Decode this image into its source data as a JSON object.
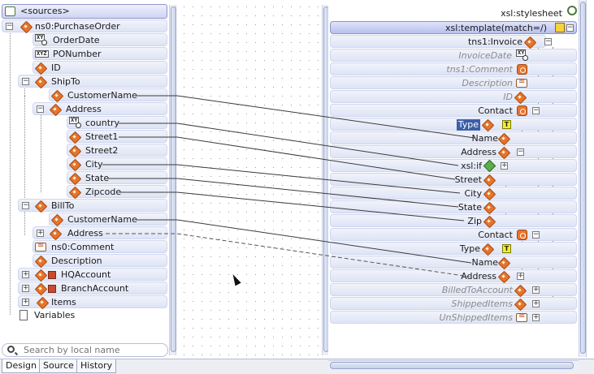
{
  "sources": {
    "header": "<sources>",
    "tree": [
      {
        "label": "ns0:PurchaseOrder",
        "icon": "element-icon",
        "expand": "−"
      },
      {
        "label": "OrderDate",
        "icon": "attribute-icon"
      },
      {
        "label": "PONumber",
        "icon": "attribute-icon"
      },
      {
        "label": "ID",
        "icon": "element-icon"
      },
      {
        "label": "ShipTo",
        "icon": "element-icon",
        "expand": "−"
      },
      {
        "label": "CustomerName",
        "icon": "element-icon"
      },
      {
        "label": "Address",
        "icon": "element-icon",
        "expand": "−"
      },
      {
        "label": "country",
        "icon": "attribute-icon"
      },
      {
        "label": "Street1",
        "icon": "element-icon"
      },
      {
        "label": "Street2",
        "icon": "element-icon"
      },
      {
        "label": "City",
        "icon": "element-icon"
      },
      {
        "label": "State",
        "icon": "element-icon"
      },
      {
        "label": "Zipcode",
        "icon": "element-icon"
      },
      {
        "label": "BillTo",
        "icon": "element-icon",
        "expand": "−"
      },
      {
        "label": "CustomerName",
        "icon": "element-icon"
      },
      {
        "label": "Address",
        "icon": "element-icon",
        "expand": "+"
      },
      {
        "label": "ns0:Comment",
        "icon": "comment-icon"
      },
      {
        "label": "Description",
        "icon": "element-icon"
      },
      {
        "label": "HQAccount",
        "icon": "element-icon",
        "expand": "+"
      },
      {
        "label": "BranchAccount",
        "icon": "element-icon",
        "expand": "+"
      },
      {
        "label": "Items",
        "icon": "element-icon",
        "expand": "+"
      },
      {
        "label": "Variables",
        "icon": "document-icon"
      }
    ],
    "search_placeholder": "Search by local name"
  },
  "target": {
    "stylesheet": "xsl:stylesheet",
    "template": "xsl:template(match=/)",
    "tree": [
      {
        "label": "tns1:Invoice",
        "style": "normal"
      },
      {
        "label": "InvoiceDate",
        "style": "italic"
      },
      {
        "label": "tns1:Comment",
        "style": "italic"
      },
      {
        "label": "Description",
        "style": "italic"
      },
      {
        "label": "ID",
        "style": "italic"
      },
      {
        "label": "Contact",
        "style": "normal"
      },
      {
        "label": "Type",
        "style": "selected",
        "badge": "T"
      },
      {
        "label": "Name",
        "style": "normal"
      },
      {
        "label": "Address",
        "style": "normal"
      },
      {
        "label": "xsl:if",
        "style": "normal"
      },
      {
        "label": "Street",
        "style": "normal"
      },
      {
        "label": "City",
        "style": "normal"
      },
      {
        "label": "State",
        "style": "normal"
      },
      {
        "label": "Zip",
        "style": "normal"
      },
      {
        "label": "Contact",
        "style": "normal"
      },
      {
        "label": "Type",
        "style": "normal",
        "badge": "T"
      },
      {
        "label": "Name",
        "style": "normal"
      },
      {
        "label": "Address",
        "style": "normal"
      },
      {
        "label": "BilledToAccount",
        "style": "italic"
      },
      {
        "label": "ShippedItems",
        "style": "italic"
      },
      {
        "label": "UnShippedItems",
        "style": "italic"
      }
    ]
  },
  "tabs": [
    {
      "label": "Design",
      "active": true
    },
    {
      "label": "Source",
      "active": false
    },
    {
      "label": "History",
      "active": false
    }
  ],
  "colors": {
    "row_bg": "#dee4f5",
    "element_icon": "#e8742c",
    "selection": "#3b5ea7",
    "map_line": "#3a3a3a"
  }
}
